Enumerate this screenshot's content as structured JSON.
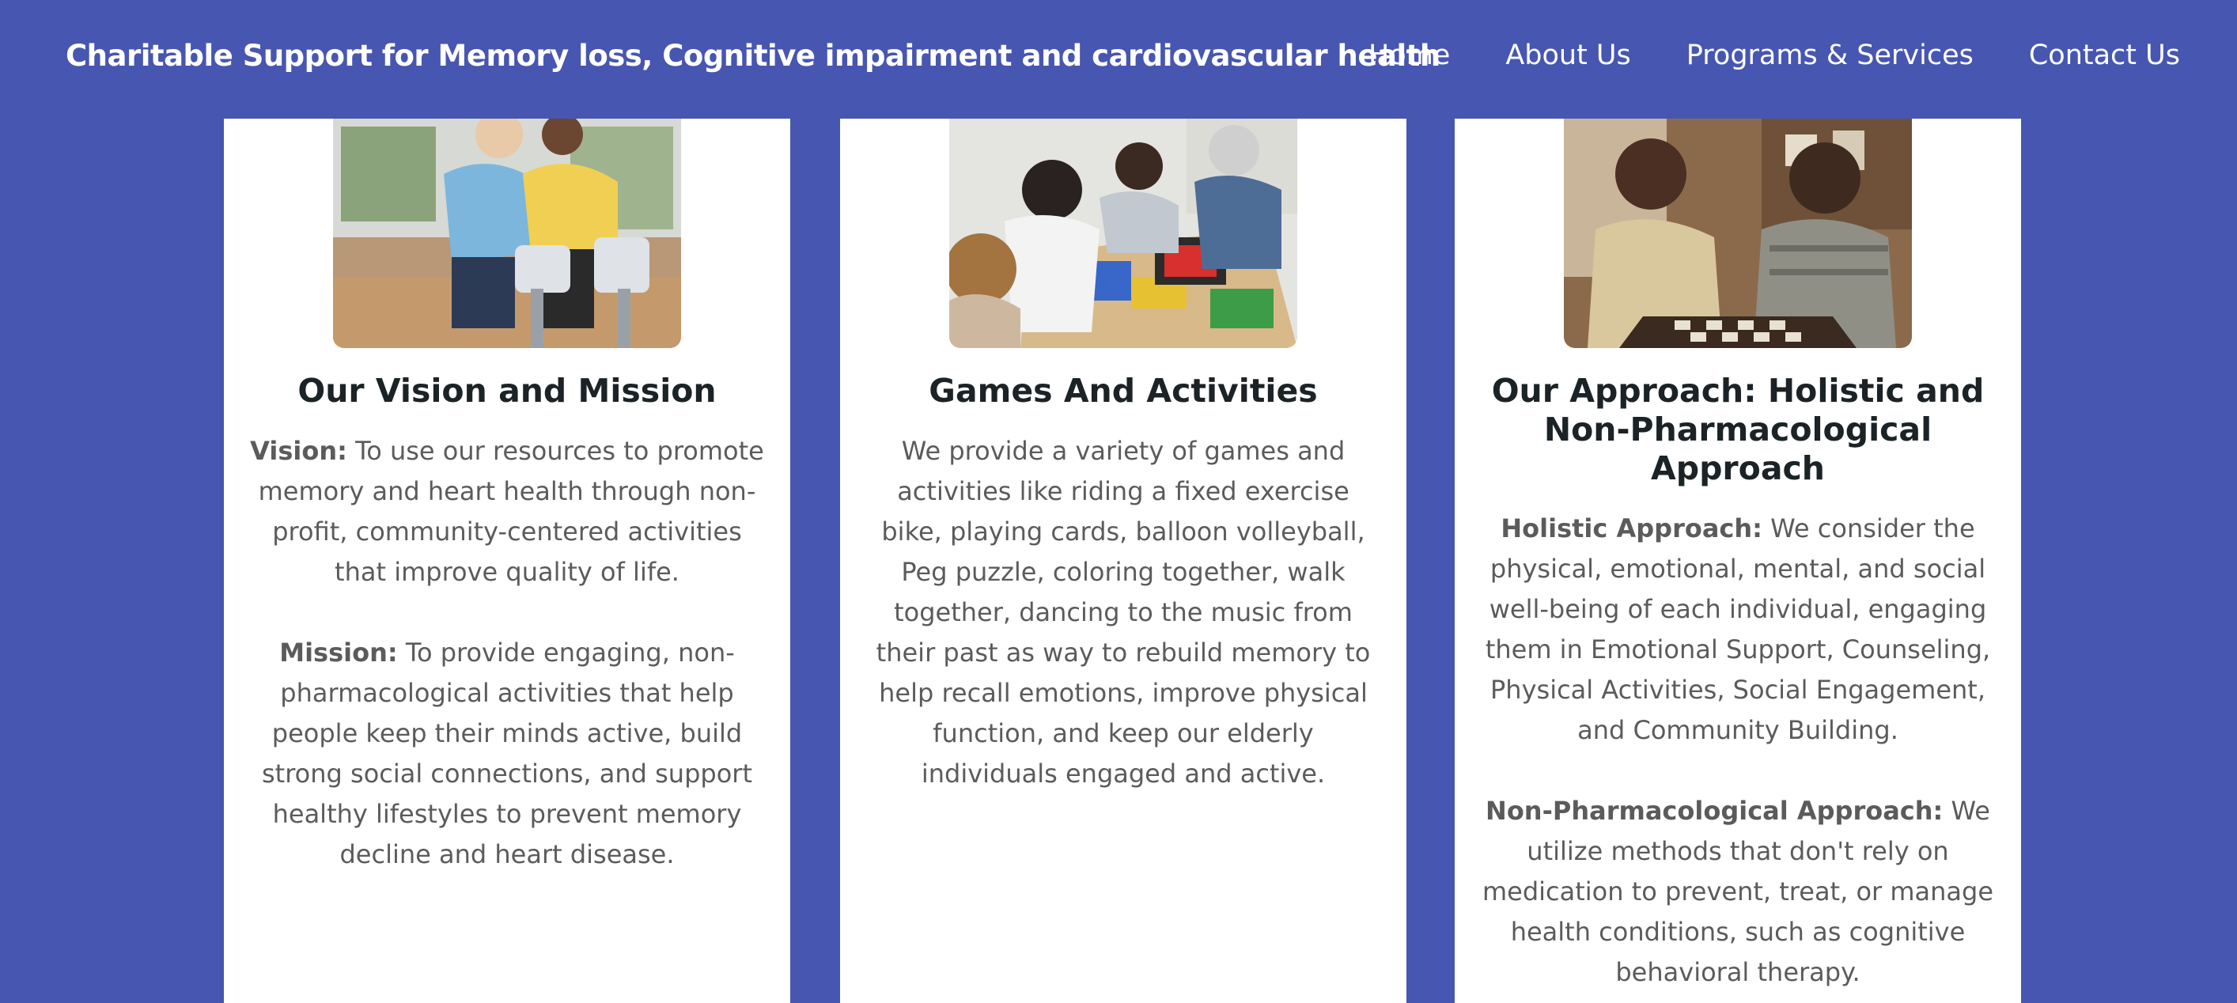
{
  "header": {
    "title": "Charitable Support for Memory loss, Cognitive impairment and cardiovascular health",
    "nav": [
      "Home",
      "About Us",
      "Programs & Services",
      "Contact Us"
    ]
  },
  "cards": [
    {
      "image_desc": "seniors on exercise bikes",
      "heading": "Our Vision and Mission",
      "paragraphs": [
        {
          "label": "Vision:",
          "text": " To use our resources to promote memory and heart health through non-profit, community-centered activities that improve quality of life."
        },
        {
          "label": "Mission:",
          "text": " To provide engaging, non-pharmacological activities that help people keep their minds active, build strong social connections, and support healthy lifestyles to prevent memory decline and heart disease."
        }
      ]
    },
    {
      "image_desc": "group playing peg puzzle",
      "heading": "Games And Activities",
      "paragraphs": [
        {
          "label": "",
          "text": "We provide a variety of games and activities like riding a fixed exercise bike, playing cards, balloon volleyball, Peg puzzle, coloring together, walk together, dancing to the music from their past as way to rebuild memory to help recall emotions, improve physical function, and keep our elderly individuals engaged and active."
        }
      ]
    },
    {
      "image_desc": "two seniors playing checkers",
      "heading": "Our Approach: Holistic and Non-Pharmacological Approach",
      "paragraphs": [
        {
          "label": "Holistic Approach:",
          "text": " We consider the physical, emotional, mental, and social well-being of each individual, engaging them in Emotional Support, Counseling, Physical Activities, Social Engagement, and Community Building."
        },
        {
          "label": "Non-Pharmacological Approach:",
          "text": " We utilize methods that don't rely on medication to prevent, treat, or manage health conditions, such as cognitive behavioral therapy."
        }
      ]
    }
  ],
  "colors": {
    "background": "#4756b1",
    "card": "#ffffff",
    "heading": "#1c2326",
    "body_text": "#5b5b5b"
  }
}
